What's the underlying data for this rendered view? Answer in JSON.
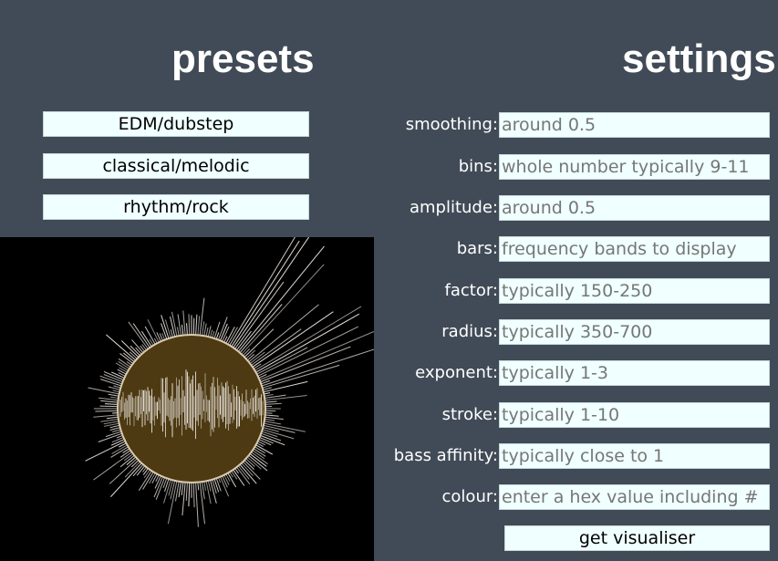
{
  "presets": {
    "title": "presets",
    "buttons": [
      {
        "label": "EDM/dubstep"
      },
      {
        "label": "classical/melodic"
      },
      {
        "label": "rhythm/rock"
      }
    ]
  },
  "settings": {
    "title": "settings",
    "fields": [
      {
        "label": "smoothing:",
        "placeholder": "around 0.5",
        "value": ""
      },
      {
        "label": "bins:",
        "placeholder": "whole number typically 9-11",
        "value": ""
      },
      {
        "label": "amplitude:",
        "placeholder": "around 0.5",
        "value": ""
      },
      {
        "label": "bars:",
        "placeholder": "frequency bands to display",
        "value": ""
      },
      {
        "label": "factor:",
        "placeholder": "typically 150-250",
        "value": ""
      },
      {
        "label": "radius:",
        "placeholder": "typically 350-700",
        "value": ""
      },
      {
        "label": "exponent:",
        "placeholder": "typically 1-3",
        "value": ""
      },
      {
        "label": "stroke:",
        "placeholder": "typically 1-10",
        "value": ""
      },
      {
        "label": "bass affinity:",
        "placeholder": "typically close to 1",
        "value": ""
      },
      {
        "label": "colour:",
        "placeholder": "enter a hex value including #",
        "value": ""
      }
    ],
    "submit_label": "get visualiser"
  },
  "visualiser": {
    "background_color": "#000000",
    "circle_fill": "#4d3a12",
    "circle_stroke": "#d9cbb0",
    "bar_color": "#e8e2dc"
  },
  "colors": {
    "page_background": "#414b57",
    "button_background": "#f0ffff",
    "text_light": "#ffffff"
  }
}
